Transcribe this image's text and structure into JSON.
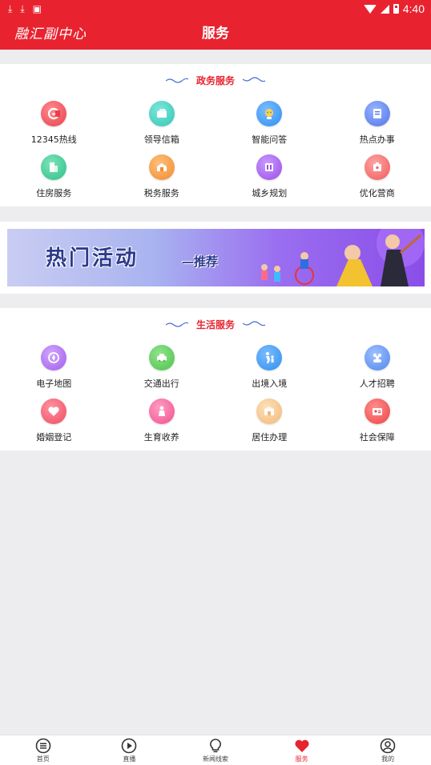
{
  "status_bar": {
    "icons": [
      "download-icon",
      "download-icon",
      "notification-icon"
    ],
    "time": "4:40"
  },
  "header": {
    "logo_text": "融汇副中心",
    "title": "服务"
  },
  "gov_section": {
    "title": "政务服务",
    "items": [
      {
        "label": "12345热线",
        "icon": "hotline-icon",
        "color": "#e8404a"
      },
      {
        "label": "领导信箱",
        "icon": "mailbox-icon",
        "color": "#2fc7b6"
      },
      {
        "label": "智能问答",
        "icon": "robot-icon",
        "color": "#2d8ff0"
      },
      {
        "label": "热点办事",
        "icon": "document-icon",
        "color": "#4f74e8"
      },
      {
        "label": "住房服务",
        "icon": "building-icon",
        "color": "#2cc08a"
      },
      {
        "label": "税务服务",
        "icon": "tax-icon",
        "color": "#f08a2e"
      },
      {
        "label": "城乡规划",
        "icon": "city-plan-icon",
        "color": "#9a4be8"
      },
      {
        "label": "优化营商",
        "icon": "business-icon",
        "color": "#ee5a5a"
      }
    ]
  },
  "banner": {
    "main_text": "热门活动",
    "sub_text": "—推荐"
  },
  "life_section": {
    "title": "生活服务",
    "items": [
      {
        "label": "电子地图",
        "icon": "map-icon",
        "color": "#a05ce8"
      },
      {
        "label": "交通出行",
        "icon": "car-icon",
        "color": "#4cc24a"
      },
      {
        "label": "出境入境",
        "icon": "travel-icon",
        "color": "#2d8ff0"
      },
      {
        "label": "人才招聘",
        "icon": "people-icon",
        "color": "#4f86ee"
      },
      {
        "label": "婚姻登记",
        "icon": "heart-icon",
        "color": "#ef4a5e"
      },
      {
        "label": "生育收养",
        "icon": "baby-icon",
        "color": "#f0508c"
      },
      {
        "label": "居住办理",
        "icon": "house-icon",
        "color": "#f0b878"
      },
      {
        "label": "社会保障",
        "icon": "id-card-icon",
        "color": "#ec4444"
      }
    ]
  },
  "tabbar": {
    "tabs": [
      {
        "label": "首页",
        "icon": "home-list-icon",
        "active": false
      },
      {
        "label": "直播",
        "icon": "play-icon",
        "active": false
      },
      {
        "label": "新闻线索",
        "icon": "lightbulb-icon",
        "active": false
      },
      {
        "label": "服务",
        "icon": "heart-icon",
        "active": true
      },
      {
        "label": "我的",
        "icon": "user-icon",
        "active": false
      }
    ],
    "active_color": "#e8232f"
  },
  "colors": {
    "brand": "#e8232f",
    "background": "#ededf0"
  }
}
